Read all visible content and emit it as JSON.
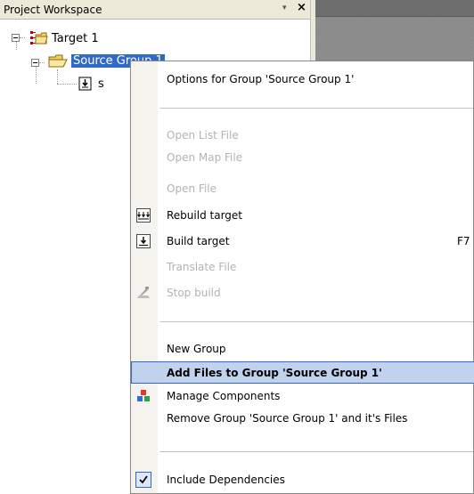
{
  "panel": {
    "title": "Project Workspace",
    "pin_glyph": "▾",
    "close_glyph": "×"
  },
  "tree": {
    "target_label": "Target 1",
    "group_label": "Source Group 1",
    "file_label": "s"
  },
  "menu": {
    "options": "Options for Group 'Source Group 1'",
    "open_list": "Open List File",
    "open_map": "Open Map File",
    "open_file": "Open File",
    "rebuild": "Rebuild target",
    "build": "Build target",
    "build_shortcut": "F7",
    "translate": "Translate File",
    "stop": "Stop build",
    "new_group": "New Group",
    "add_files": "Add Files to Group 'Source Group 1'",
    "manage": "Manage Components",
    "remove": "Remove Group 'Source Group 1' and it's Files",
    "include_deps": "Include Dependencies"
  },
  "icons": {
    "target": "project-target-icon",
    "folder": "folder-open-icon",
    "file": "source-file-icon",
    "rebuild": "rebuild-icon",
    "build": "build-icon",
    "stop": "stop-build-icon",
    "manage": "manage-components-icon",
    "check": "checkmark-icon"
  },
  "colors": {
    "selection": "#316ac5",
    "highlight": "#c1d2ee",
    "disabled_text": "#b3b3b3"
  }
}
